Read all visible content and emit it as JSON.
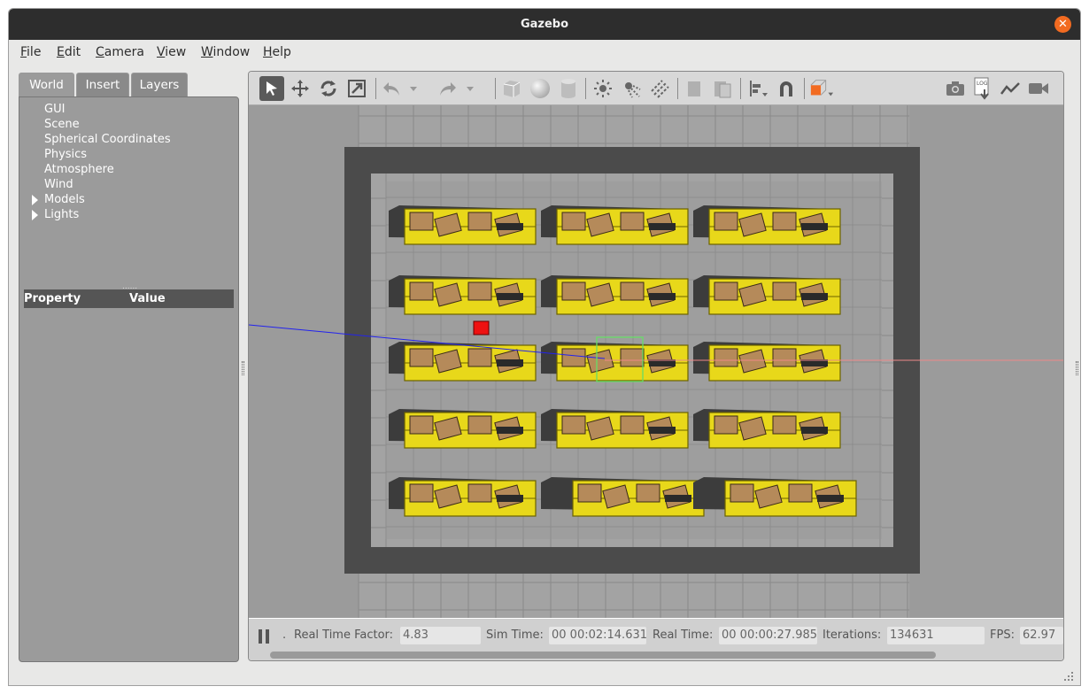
{
  "window": {
    "title": "Gazebo"
  },
  "menu": [
    {
      "prefix": "",
      "accel": "F",
      "rest": "ile"
    },
    {
      "prefix": "",
      "accel": "E",
      "rest": "dit"
    },
    {
      "prefix": "",
      "accel": "C",
      "rest": "amera"
    },
    {
      "prefix": "",
      "accel": "V",
      "rest": "iew"
    },
    {
      "prefix": "",
      "accel": "W",
      "rest": "indow"
    },
    {
      "prefix": "",
      "accel": "H",
      "rest": "elp"
    }
  ],
  "tabs": [
    "World",
    "Insert",
    "Layers"
  ],
  "tree": {
    "items": [
      "GUI",
      "Scene",
      "Spherical Coordinates",
      "Physics",
      "Atmosphere",
      "Wind",
      "Models",
      "Lights"
    ]
  },
  "properties": {
    "col_property": "Property",
    "col_value": "Value"
  },
  "toolbar": {
    "icons": [
      "select-icon",
      "translate-icon",
      "rotate-icon",
      "scale-icon",
      "undo-icon",
      "redo-icon",
      "box-icon",
      "sphere-icon",
      "cylinder-icon",
      "point-light-icon",
      "spot-light-icon",
      "directional-light-icon",
      "copy-icon",
      "paste-icon",
      "align-icon",
      "snap-icon",
      "view-angle-icon",
      "screenshot-icon",
      "log-icon",
      "plot-icon",
      "record-icon"
    ],
    "log_text": "LOG"
  },
  "status": {
    "rtf_label": "Real Time Factor:",
    "rtf_value": "4.83",
    "sim_label": "Sim Time:",
    "sim_value": "00 00:02:14.631",
    "real_label": "Real Time:",
    "real_value": "00 00:00:27.985",
    "iter_label": "Iterations:",
    "iter_value": "134631",
    "fps_label": "FPS:",
    "fps_value": "62.97",
    "step_dot": "."
  },
  "colors": {
    "shelf_yellow": "#e8d81a",
    "box_brown": "#b58a5a",
    "wall_gray": "#4b4b4b",
    "floor_gray": "#9b9b9b",
    "robot_red": "#ee1111",
    "selection_green": "#66dd66",
    "orange_accent": "#f26b21"
  }
}
